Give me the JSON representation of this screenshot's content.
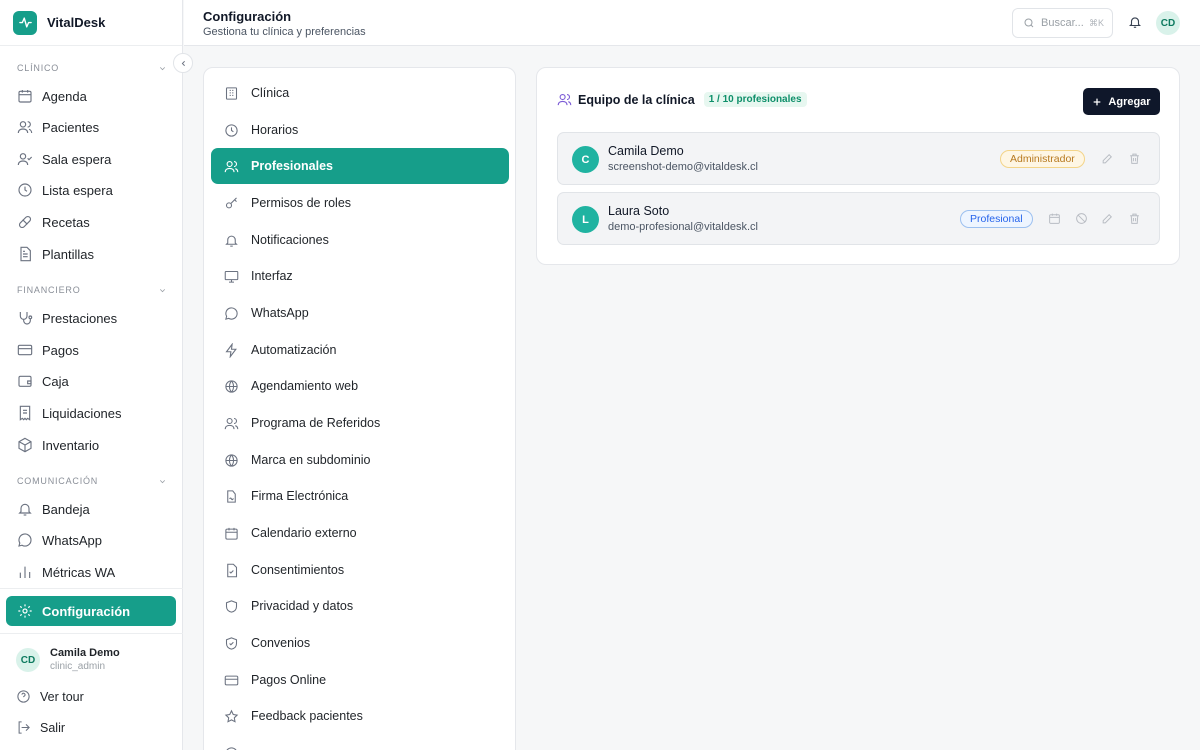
{
  "brand": {
    "name": "VitalDesk",
    "accent": "#169e8a"
  },
  "sidebar": {
    "sections": [
      {
        "label": "CLÍNICO",
        "items": [
          {
            "label": "Agenda",
            "icon": "calendar-icon"
          },
          {
            "label": "Pacientes",
            "icon": "users-icon"
          },
          {
            "label": "Sala espera",
            "icon": "user-check-icon"
          },
          {
            "label": "Lista espera",
            "icon": "clock-icon"
          },
          {
            "label": "Recetas",
            "icon": "pill-icon"
          },
          {
            "label": "Plantillas",
            "icon": "file-text-icon"
          }
        ]
      },
      {
        "label": "FINANCIERO",
        "items": [
          {
            "label": "Prestaciones",
            "icon": "stethoscope-icon"
          },
          {
            "label": "Pagos",
            "icon": "credit-card-icon"
          },
          {
            "label": "Caja",
            "icon": "wallet-icon"
          },
          {
            "label": "Liquidaciones",
            "icon": "receipt-icon"
          },
          {
            "label": "Inventario",
            "icon": "package-icon"
          }
        ]
      },
      {
        "label": "COMUNICACIÓN",
        "items": [
          {
            "label": "Bandeja",
            "icon": "bell-icon"
          },
          {
            "label": "WhatsApp",
            "icon": "message-circle-icon"
          },
          {
            "label": "Métricas WA",
            "icon": "bar-chart-icon"
          }
        ]
      }
    ],
    "active_item": {
      "label": "Configuración",
      "icon": "gear-icon"
    },
    "user": {
      "initials": "CD",
      "name": "Camila Demo",
      "role": "clinic_admin"
    },
    "footer": [
      {
        "label": "Ver tour",
        "icon": "help-circle-icon"
      },
      {
        "label": "Salir",
        "icon": "logout-icon"
      }
    ]
  },
  "header": {
    "title": "Configuración",
    "subtitle": "Gestiona tu clínica y preferencias",
    "search_placeholder": "Buscar...",
    "search_shortcut": "⌘K",
    "avatar_initials": "CD"
  },
  "settings_menu": {
    "active_index": 2,
    "items": [
      {
        "label": "Clínica",
        "icon": "building-icon"
      },
      {
        "label": "Horarios",
        "icon": "clock-icon"
      },
      {
        "label": "Profesionales",
        "icon": "users-icon"
      },
      {
        "label": "Permisos de roles",
        "icon": "key-icon"
      },
      {
        "label": "Notificaciones",
        "icon": "bell-icon"
      },
      {
        "label": "Interfaz",
        "icon": "monitor-icon"
      },
      {
        "label": "WhatsApp",
        "icon": "message-circle-icon"
      },
      {
        "label": "Automatización",
        "icon": "zap-icon"
      },
      {
        "label": "Agendamiento web",
        "icon": "globe-icon"
      },
      {
        "label": "Programa de Referidos",
        "icon": "users-icon"
      },
      {
        "label": "Marca en subdominio",
        "icon": "globe-icon"
      },
      {
        "label": "Firma Electrónica",
        "icon": "file-signature-icon"
      },
      {
        "label": "Calendario externo",
        "icon": "calendar-icon"
      },
      {
        "label": "Consentimientos",
        "icon": "file-check-icon"
      },
      {
        "label": "Privacidad y datos",
        "icon": "shield-icon"
      },
      {
        "label": "Convenios",
        "icon": "shield-check-icon"
      },
      {
        "label": "Pagos Online",
        "icon": "credit-card-icon"
      },
      {
        "label": "Feedback pacientes",
        "icon": "star-icon"
      }
    ]
  },
  "team": {
    "title": "Equipo de la clínica",
    "count": "1 / 10 profesionales",
    "add_label": "Agregar",
    "members": [
      {
        "initial": "C",
        "name": "Camila Demo",
        "email": "screenshot-demo@vitaldesk.cl",
        "role": "Administrador"
      },
      {
        "initial": "L",
        "name": "Laura Soto",
        "email": "demo-profesional@vitaldesk.cl",
        "role": "Profesional"
      }
    ]
  }
}
